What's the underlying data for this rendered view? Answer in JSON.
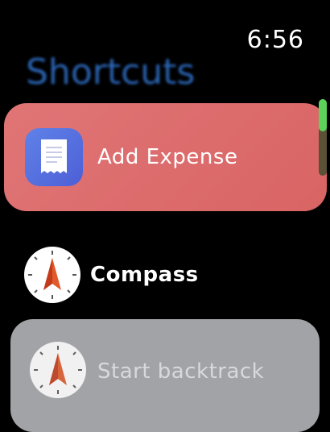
{
  "status": {
    "time": "6:56"
  },
  "header": {
    "title": "Shortcuts"
  },
  "shortcuts": [
    {
      "label": "Add Expense",
      "icon": "receipt-icon"
    },
    {
      "label": "Compass",
      "icon": "compass-icon"
    },
    {
      "label": "Start backtrack",
      "icon": "compass-icon"
    }
  ],
  "colors": {
    "expense_card": "#dd6b6b",
    "backtrack_card": "#a2a3a7",
    "title": "#2f6fc6",
    "scroll_thumb": "#5dd35b"
  }
}
